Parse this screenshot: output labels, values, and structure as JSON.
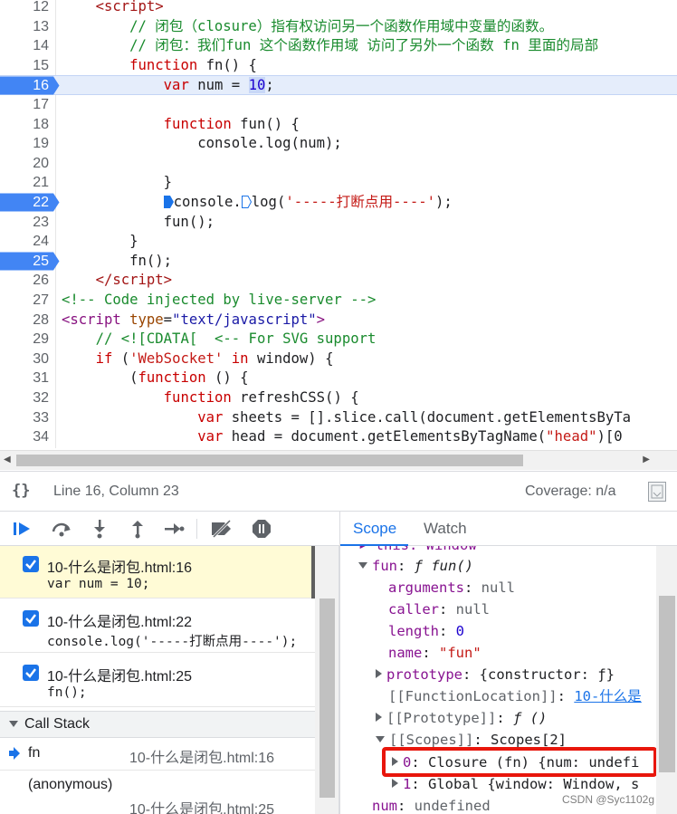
{
  "editor": {
    "lines": [
      {
        "n": "12",
        "html": "    <span class=\"kw\">&lt;script&gt;</span>"
      },
      {
        "n": "13",
        "html": "        <span class=\"cm\">// 闭包（closure）指有权访问另一个函数作用域中变量的函数。</span>"
      },
      {
        "n": "14",
        "html": "        <span class=\"cm\">// 闭包：我们fun 这个函数作用域 访问了另外一个函数 fn 里面的局部</span>"
      },
      {
        "n": "15",
        "html": "        <span class=\"pl\">function</span> fn() {"
      },
      {
        "n": "16",
        "html": "            <span class=\"pl\">var</span> num = <span class=\"sel-num\">10</span>;",
        "exec": true,
        "bp": true
      },
      {
        "n": "17",
        "html": ""
      },
      {
        "n": "18",
        "html": "            <span class=\"pl\">function</span> fun() {"
      },
      {
        "n": "19",
        "html": "                console.log(num);"
      },
      {
        "n": "20",
        "html": ""
      },
      {
        "n": "21",
        "html": "            }"
      },
      {
        "n": "22",
        "html": "            <span class=\"inline-bp\" data-name=\"inline-breakpoint-icon\"><svg width=\"11\" height=\"14\"><path d=\"M0 0 H7 L11 7 L7 14 H0 Z\" fill=\"#1a73e8\"/></svg></span>console.<span class=\"inline-bp\" data-name=\"inline-breakpoint-icon\"><svg width=\"11\" height=\"14\"><path d=\"M0.5 0.5 H7 L10.5 7 L7 13.5 H0.5 Z\" fill=\"#fff\" stroke=\"#1a73e8\"/></svg></span>log(<span class=\"str\">'-----打断点用----'</span>);",
        "bp": true
      },
      {
        "n": "23",
        "html": "            fun();"
      },
      {
        "n": "24",
        "html": "        }"
      },
      {
        "n": "25",
        "html": "        fn();",
        "bp": true
      },
      {
        "n": "26",
        "html": "    <span class=\"kw\">&lt;/script&gt;</span>"
      },
      {
        "n": "27",
        "html": "<span class=\"cm\">&lt;!-- Code injected by live-server --&gt;</span>"
      },
      {
        "n": "28",
        "html": "<span class=\"tag\">&lt;script</span> <span class=\"attr\">type</span>=<span class=\"attrv\">\"text/javascript\"</span><span class=\"tag\">&gt;</span>"
      },
      {
        "n": "29",
        "html": "    <span class=\"cm\">// &lt;![CDATA[  &lt;-- For SVG support</span>"
      },
      {
        "n": "30",
        "html": "    <span class=\"pl\">if</span> (<span class=\"str\">'WebSocket'</span> <span class=\"pl\">in</span> window) {"
      },
      {
        "n": "31",
        "html": "        (<span class=\"pl\">function</span> () {"
      },
      {
        "n": "32",
        "html": "            <span class=\"pl\">function</span> refreshCSS() {"
      },
      {
        "n": "33",
        "html": "                <span class=\"pl\">var</span> sheets = [].slice.call(document.getElementsByTa"
      },
      {
        "n": "34",
        "html": "                <span class=\"pl\">var</span> head = document.getElementsByTagName(<span class=\"str\">\"head\"</span>)[0"
      }
    ]
  },
  "status": {
    "braces": "{}",
    "position": "Line 16, Column 23",
    "coverage": "Coverage: n/a"
  },
  "tabs": {
    "scope": "Scope",
    "watch": "Watch"
  },
  "breakpoints": [
    {
      "file": "10-什么是闭包.html:16",
      "code": "var num = 10;",
      "hit": true
    },
    {
      "file": "10-什么是闭包.html:22",
      "code": "console.log('-----打断点用----');",
      "hit": false
    },
    {
      "file": "10-什么是闭包.html:25",
      "code": "fn();",
      "hit": false
    }
  ],
  "callstack": {
    "title": "Call Stack",
    "frames": [
      {
        "name": "fn",
        "loc": "10-什么是闭包.html:16",
        "current": true
      },
      {
        "name": "(anonymous)",
        "loc": "10-什么是闭包.html:25",
        "current": false
      }
    ]
  },
  "scope": {
    "this_row": "▸ this: Window",
    "fun_key": "fun",
    "fun_val": "ƒ fun()",
    "arguments_key": "arguments",
    "arguments_val": "null",
    "caller_key": "caller",
    "caller_val": "null",
    "length_key": "length",
    "length_val": "0",
    "name_key": "name",
    "name_val": "\"fun\"",
    "prototype_key": "prototype",
    "prototype_val": "{constructor: ƒ}",
    "floc_key": "[[FunctionLocation]]",
    "floc_val": "10-什么是",
    "proto_key": "[[Prototype]]",
    "proto_val": "ƒ ()",
    "scopes_key": "[[Scopes]]",
    "scopes_val": "Scopes[2]",
    "closure_key": "0",
    "closure_val": "Closure (fn) {num: undefi",
    "global_key": "1",
    "global_val": "Global {window: Window, s",
    "num_key": "num",
    "num_val": "undefined"
  },
  "watermark": "CSDN @Syc1102g"
}
